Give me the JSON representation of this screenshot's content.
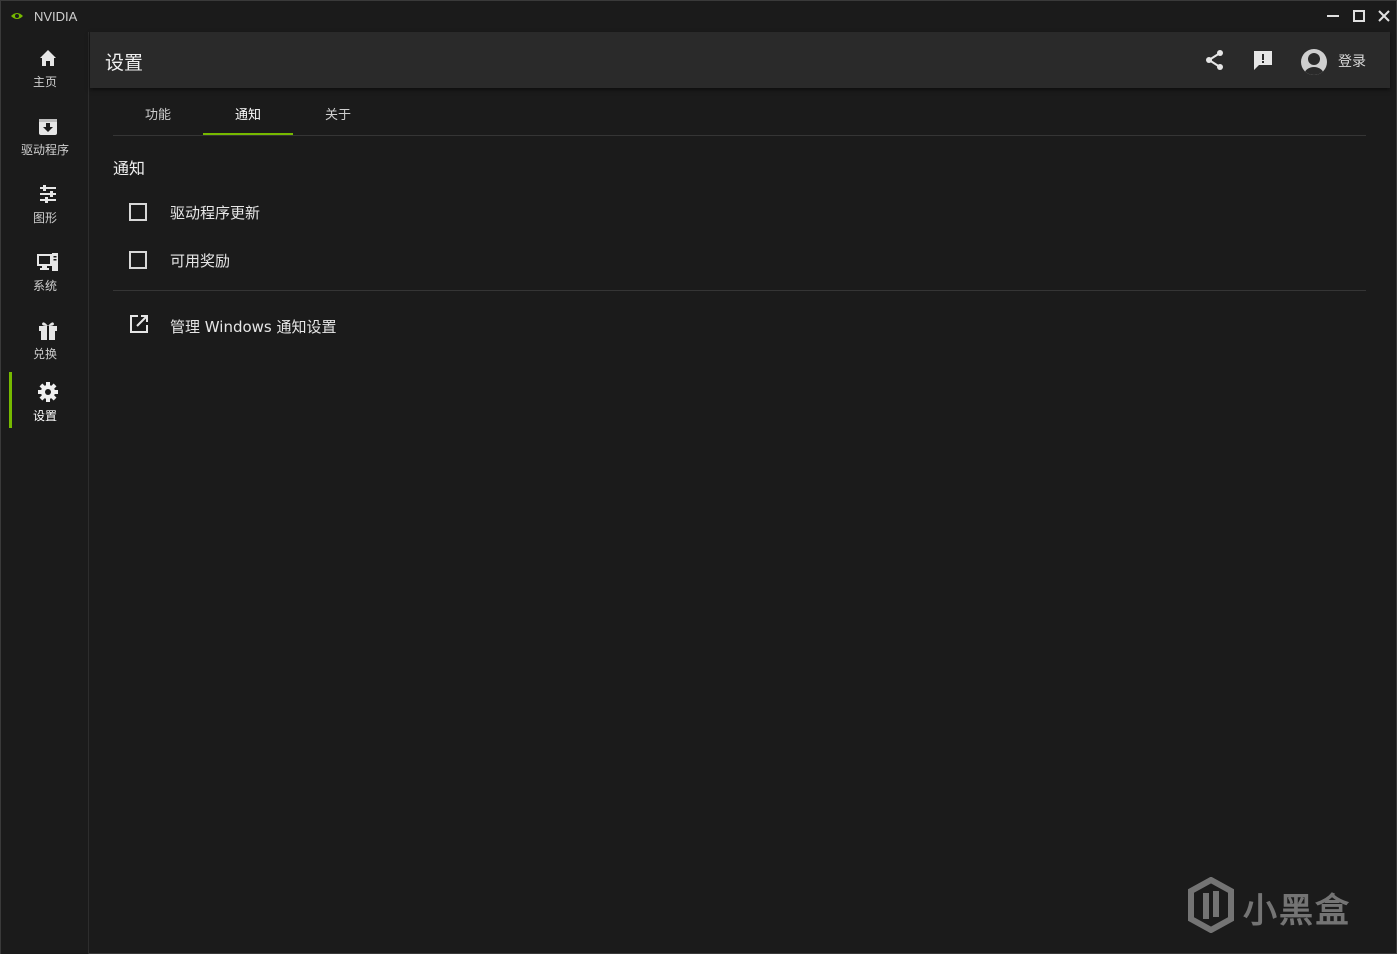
{
  "window": {
    "title": "NVIDIA"
  },
  "sidebar": {
    "items": [
      {
        "label": "主页",
        "icon": "home-icon"
      },
      {
        "label": "驱动程序",
        "icon": "download-icon"
      },
      {
        "label": "图形",
        "icon": "sliders-icon"
      },
      {
        "label": "系统",
        "icon": "system-icon"
      },
      {
        "label": "兑换",
        "icon": "gift-icon"
      },
      {
        "label": "设置",
        "icon": "gear-icon",
        "active": true
      }
    ]
  },
  "header": {
    "title": "设置",
    "login_label": "登录"
  },
  "tabs": [
    {
      "label": "功能"
    },
    {
      "label": "通知",
      "active": true
    },
    {
      "label": "关于"
    }
  ],
  "notifications": {
    "section_title": "通知",
    "options": [
      {
        "label": "驱动程序更新",
        "checked": false
      },
      {
        "label": "可用奖励",
        "checked": false
      }
    ],
    "manage_link": "管理 Windows 通知设置"
  },
  "watermark": {
    "text": "小黑盒"
  },
  "colors": {
    "accent": "#76b900",
    "background": "#1b1b1b",
    "header": "#2a2a2a"
  }
}
